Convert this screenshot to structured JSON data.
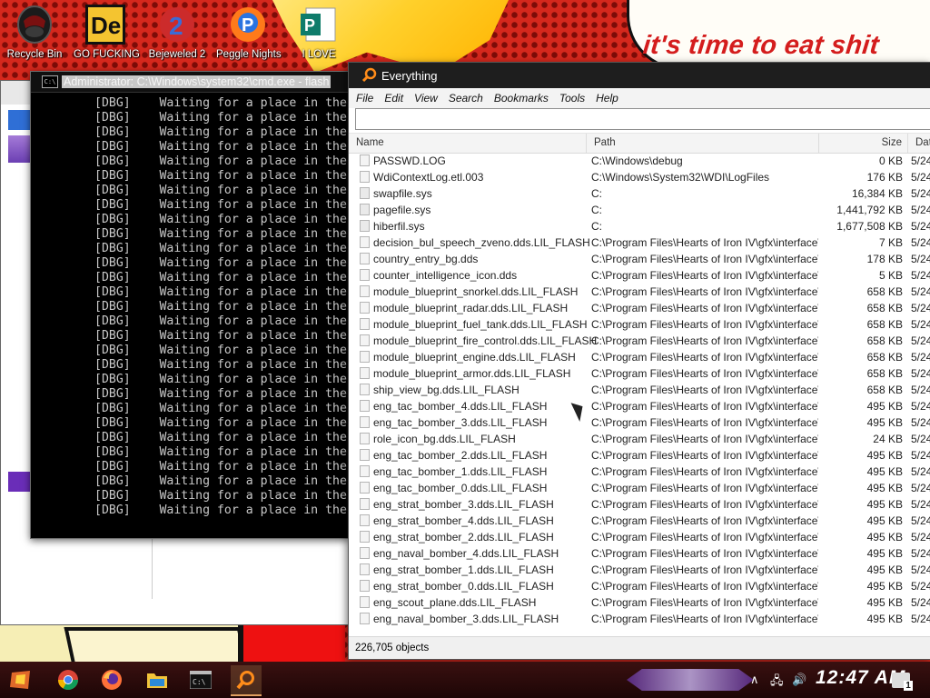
{
  "wallpaper": {
    "caption": "it's time to eat shit"
  },
  "desktop_icons": [
    {
      "label": "Recycle Bin"
    },
    {
      "label": "GO FUCKING"
    },
    {
      "label": "Bejeweled 2"
    },
    {
      "label": "Peggle Nights"
    },
    {
      "label": "I LOVE"
    }
  ],
  "cmd": {
    "title": "Administrator: C:\\Windows\\system32\\cmd.exe - flash",
    "lines": [
      "[DBG]    Waiting for a place in the",
      "[DBG]    Waiting for a place in the",
      "[DBG]    Waiting for a place in the",
      "[DBG]    Waiting for a place in the",
      "[DBG]    Waiting for a place in the",
      "[DBG]    Waiting for a place in the",
      "[DBG]    Waiting for a place in the",
      "[DBG]    Waiting for a place in the",
      "[DBG]    Waiting for a place in the",
      "[DBG]    Waiting for a place in the",
      "[DBG]    Waiting for a place in the",
      "[DBG]    Waiting for a place in the",
      "[DBG]    Waiting for a place in the",
      "[DBG]    Waiting for a place in the",
      "[DBG]    Waiting for a place in the",
      "[DBG]    Waiting for a place in the",
      "[DBG]    Waiting for a place in the",
      "[DBG]    Waiting for a place in the",
      "[DBG]    Waiting for a place in the",
      "[DBG]    Waiting for a place in the",
      "[DBG]    Waiting for a place in the",
      "[DBG]    Waiting for a place in the",
      "[DBG]    Waiting for a place in the",
      "[DBG]    Waiting for a place in the",
      "[DBG]    Waiting for a place in the",
      "[DBG]    Waiting for a place in the",
      "[DBG]    Waiting for a place in the",
      "[DBG]    Waiting for a place in the",
      "[DBG]    Waiting for a place in the"
    ]
  },
  "everything": {
    "title": "Everything",
    "menu": [
      "File",
      "Edit",
      "View",
      "Search",
      "Bookmarks",
      "Tools",
      "Help"
    ],
    "search_value": "",
    "columns": {
      "name": "Name",
      "path": "Path",
      "size": "Size",
      "date": "Date"
    },
    "rows": [
      {
        "name": "PASSWD.LOG",
        "path": "C:\\Windows\\debug",
        "size": "0 KB",
        "date": "5/24",
        "icon": "file-icon"
      },
      {
        "name": "WdiContextLog.etl.003",
        "path": "C:\\Windows\\System32\\WDI\\LogFiles",
        "size": "176 KB",
        "date": "5/24",
        "icon": "file-icon"
      },
      {
        "name": "swapfile.sys",
        "path": "C:",
        "size": "16,384 KB",
        "date": "5/24",
        "icon": "system-file-icon"
      },
      {
        "name": "pagefile.sys",
        "path": "C:",
        "size": "1,441,792 KB",
        "date": "5/24",
        "icon": "system-file-icon"
      },
      {
        "name": "hiberfil.sys",
        "path": "C:",
        "size": "1,677,508 KB",
        "date": "5/24",
        "icon": "system-file-icon"
      },
      {
        "name": "decision_bul_speech_zveno.dds.LIL_FLASH",
        "path": "C:\\Program Files\\Hearts of Iron IV\\gfx\\interface\\...",
        "size": "7 KB",
        "date": "5/24",
        "icon": "file-icon"
      },
      {
        "name": "country_entry_bg.dds",
        "path": "C:\\Program Files\\Hearts of Iron IV\\gfx\\interface\\...",
        "size": "178 KB",
        "date": "5/24",
        "icon": "file-icon"
      },
      {
        "name": "counter_intelligence_icon.dds",
        "path": "C:\\Program Files\\Hearts of Iron IV\\gfx\\interface\\...",
        "size": "5 KB",
        "date": "5/24",
        "icon": "file-icon"
      },
      {
        "name": "module_blueprint_snorkel.dds.LIL_FLASH",
        "path": "C:\\Program Files\\Hearts of Iron IV\\gfx\\interface\\...",
        "size": "658 KB",
        "date": "5/24",
        "icon": "file-icon"
      },
      {
        "name": "module_blueprint_radar.dds.LIL_FLASH",
        "path": "C:\\Program Files\\Hearts of Iron IV\\gfx\\interface\\...",
        "size": "658 KB",
        "date": "5/24",
        "icon": "file-icon"
      },
      {
        "name": "module_blueprint_fuel_tank.dds.LIL_FLASH",
        "path": "C:\\Program Files\\Hearts of Iron IV\\gfx\\interface\\...",
        "size": "658 KB",
        "date": "5/24",
        "icon": "file-icon"
      },
      {
        "name": "module_blueprint_fire_control.dds.LIL_FLASH",
        "path": "C:\\Program Files\\Hearts of Iron IV\\gfx\\interface\\...",
        "size": "658 KB",
        "date": "5/24",
        "icon": "file-icon"
      },
      {
        "name": "module_blueprint_engine.dds.LIL_FLASH",
        "path": "C:\\Program Files\\Hearts of Iron IV\\gfx\\interface\\...",
        "size": "658 KB",
        "date": "5/24",
        "icon": "file-icon"
      },
      {
        "name": "module_blueprint_armor.dds.LIL_FLASH",
        "path": "C:\\Program Files\\Hearts of Iron IV\\gfx\\interface\\...",
        "size": "658 KB",
        "date": "5/24",
        "icon": "file-icon"
      },
      {
        "name": "ship_view_bg.dds.LIL_FLASH",
        "path": "C:\\Program Files\\Hearts of Iron IV\\gfx\\interface\\...",
        "size": "658 KB",
        "date": "5/24",
        "icon": "file-icon"
      },
      {
        "name": "eng_tac_bomber_4.dds.LIL_FLASH",
        "path": "C:\\Program Files\\Hearts of Iron IV\\gfx\\interface\\...",
        "size": "495 KB",
        "date": "5/24",
        "icon": "file-icon"
      },
      {
        "name": "eng_tac_bomber_3.dds.LIL_FLASH",
        "path": "C:\\Program Files\\Hearts of Iron IV\\gfx\\interface\\...",
        "size": "495 KB",
        "date": "5/24",
        "icon": "file-icon"
      },
      {
        "name": "role_icon_bg.dds.LIL_FLASH",
        "path": "C:\\Program Files\\Hearts of Iron IV\\gfx\\interface\\...",
        "size": "24 KB",
        "date": "5/24",
        "icon": "file-icon"
      },
      {
        "name": "eng_tac_bomber_2.dds.LIL_FLASH",
        "path": "C:\\Program Files\\Hearts of Iron IV\\gfx\\interface\\...",
        "size": "495 KB",
        "date": "5/24",
        "icon": "file-icon"
      },
      {
        "name": "eng_tac_bomber_1.dds.LIL_FLASH",
        "path": "C:\\Program Files\\Hearts of Iron IV\\gfx\\interface\\...",
        "size": "495 KB",
        "date": "5/24",
        "icon": "file-icon"
      },
      {
        "name": "eng_tac_bomber_0.dds.LIL_FLASH",
        "path": "C:\\Program Files\\Hearts of Iron IV\\gfx\\interface\\...",
        "size": "495 KB",
        "date": "5/24",
        "icon": "file-icon"
      },
      {
        "name": "eng_strat_bomber_3.dds.LIL_FLASH",
        "path": "C:\\Program Files\\Hearts of Iron IV\\gfx\\interface\\...",
        "size": "495 KB",
        "date": "5/24",
        "icon": "file-icon"
      },
      {
        "name": "eng_strat_bomber_4.dds.LIL_FLASH",
        "path": "C:\\Program Files\\Hearts of Iron IV\\gfx\\interface\\...",
        "size": "495 KB",
        "date": "5/24",
        "icon": "file-icon"
      },
      {
        "name": "eng_strat_bomber_2.dds.LIL_FLASH",
        "path": "C:\\Program Files\\Hearts of Iron IV\\gfx\\interface\\...",
        "size": "495 KB",
        "date": "5/24",
        "icon": "file-icon"
      },
      {
        "name": "eng_naval_bomber_4.dds.LIL_FLASH",
        "path": "C:\\Program Files\\Hearts of Iron IV\\gfx\\interface\\...",
        "size": "495 KB",
        "date": "5/24",
        "icon": "file-icon"
      },
      {
        "name": "eng_strat_bomber_1.dds.LIL_FLASH",
        "path": "C:\\Program Files\\Hearts of Iron IV\\gfx\\interface\\...",
        "size": "495 KB",
        "date": "5/24",
        "icon": "file-icon"
      },
      {
        "name": "eng_strat_bomber_0.dds.LIL_FLASH",
        "path": "C:\\Program Files\\Hearts of Iron IV\\gfx\\interface\\...",
        "size": "495 KB",
        "date": "5/24",
        "icon": "file-icon"
      },
      {
        "name": "eng_scout_plane.dds.LIL_FLASH",
        "path": "C:\\Program Files\\Hearts of Iron IV\\gfx\\interface\\...",
        "size": "495 KB",
        "date": "5/24",
        "icon": "file-icon"
      },
      {
        "name": "eng_naval_bomber_3.dds.LIL_FLASH",
        "path": "C:\\Program Files\\Hearts of Iron IV\\gfx\\interface\\...",
        "size": "495 KB",
        "date": "5/24",
        "icon": "file-icon"
      }
    ],
    "status": "226,705 objects"
  },
  "taskbar": {
    "apps": [
      "start-icon",
      "chrome-icon",
      "firefox-icon",
      "file-explorer-icon",
      "cmd-icon",
      "everything-icon"
    ],
    "clock": "12:47 AM",
    "notification_count": "1"
  },
  "colors": {
    "accent_purple": "#5a2a86",
    "everything_title": "#1e1e1e",
    "wallpaper_red": "#d5281d"
  }
}
